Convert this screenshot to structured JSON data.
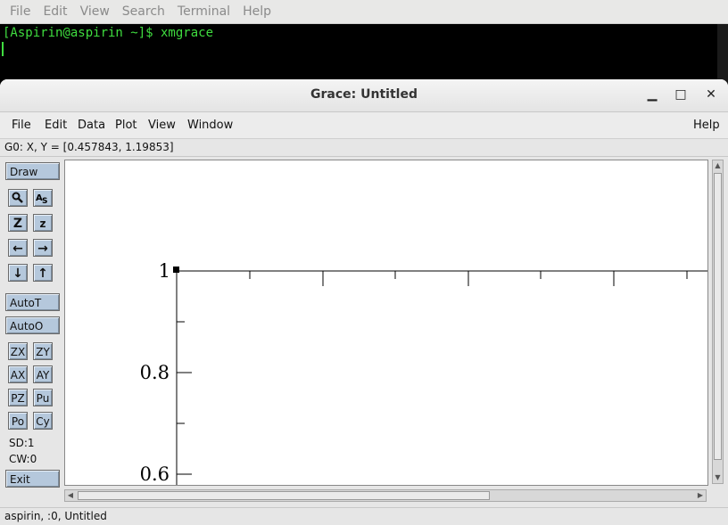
{
  "terminal": {
    "menu": [
      "File",
      "Edit",
      "View",
      "Search",
      "Terminal",
      "Help"
    ],
    "prompt_line": "[Aspirin@aspirin ~]$ xmgrace"
  },
  "window": {
    "title": "Grace: Untitled",
    "minimize_glyph": "▁",
    "maximize_glyph": "□",
    "close_glyph": "✕"
  },
  "menubar": {
    "file": "File",
    "edit": "Edit",
    "data": "Data",
    "plot": "Plot",
    "view": "View",
    "window": "Window",
    "help": "Help"
  },
  "coords": "G0: X, Y = [0.457843, 1.19853]",
  "toolbar": {
    "draw": "Draw",
    "autot": "AutoT",
    "autoo": "AutoO",
    "zx": "ZX",
    "zy": "ZY",
    "ax": "AX",
    "ay": "AY",
    "pz": "PZ",
    "pu": "Pu",
    "po": "Po",
    "cy": "Cy",
    "sd": "SD:1",
    "cw": "CW:0",
    "exit": "Exit",
    "icons": {
      "zoom": "magnifier-icon",
      "autoscale_text": "text-icon",
      "zoom_z": "zoom-in-icon",
      "zoom_out_z": "zoom-out-icon",
      "left": "arrow-left-icon",
      "right": "arrow-right-icon",
      "down": "arrow-down-icon",
      "up": "arrow-up-icon"
    }
  },
  "plot": {
    "y_ticks": [
      "1",
      "0.8",
      "0.6"
    ]
  },
  "status": "aspirin, :0, Untitled"
}
